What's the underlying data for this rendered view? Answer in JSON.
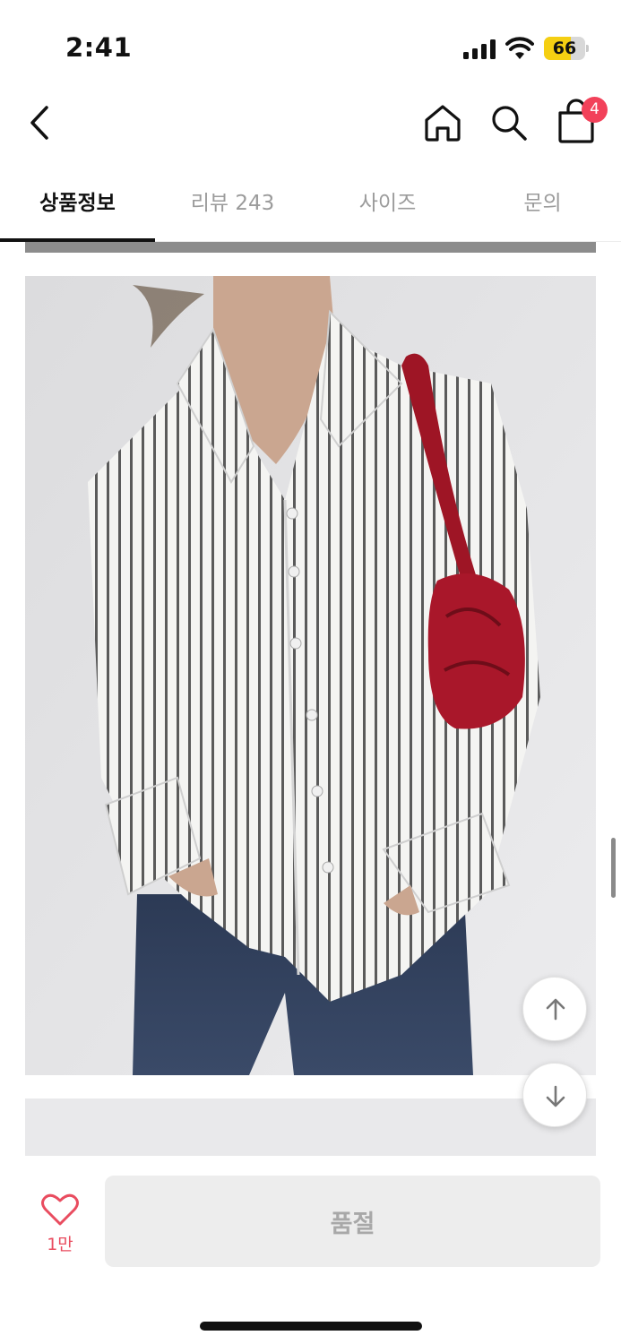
{
  "status_bar": {
    "time": "2:41",
    "battery_level": "66",
    "battery_color": "#f5cf12"
  },
  "nav": {
    "back_icon": "chevron-left-icon",
    "home_icon": "home-icon",
    "search_icon": "search-icon",
    "cart_icon": "shopping-bag-icon",
    "cart_count": "4",
    "badge_color": "#f2415a"
  },
  "tabs": [
    {
      "label": "상품정보",
      "active": true
    },
    {
      "label": "리뷰 243",
      "active": false
    },
    {
      "label": "사이즈",
      "active": false
    },
    {
      "label": "문의",
      "active": false
    }
  ],
  "content": {
    "image_description_icon": "product-photo",
    "scroll_up_icon": "arrow-up-icon",
    "scroll_down_icon": "arrow-down-icon"
  },
  "bottom_bar": {
    "like_icon": "heart-icon",
    "like_count": "1만",
    "soldout_label": "품절",
    "accent_color": "#e94c5f"
  }
}
